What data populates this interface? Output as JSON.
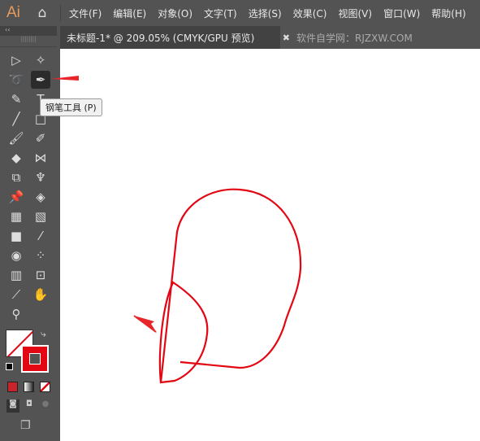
{
  "app": {
    "logo": "Ai",
    "home_icon": "home-icon"
  },
  "menu": [
    "文件(F)",
    "编辑(E)",
    "对象(O)",
    "文字(T)",
    "选择(S)",
    "效果(C)",
    "视图(V)",
    "窗口(W)",
    "帮助(H)"
  ],
  "tab": {
    "title": "未标题-1* @ 209.05% (CMYK/GPU 预览)",
    "close": "✖"
  },
  "watermark": "软件自学网：RJZXW.COM",
  "toolbar": {
    "collapse": "‹‹",
    "tooltip": "钢笔工具 (P)",
    "active_tool": "pen-tool",
    "tools": [
      "direct-selection",
      "magic-wand",
      "lasso",
      "pen",
      "curvature",
      "type",
      "line",
      "rectangle",
      "paintbrush",
      "shaper",
      "eraser",
      "reflect",
      "scale",
      "puppet-warp",
      "pin",
      "perspective",
      "mesh",
      "live-paint",
      "gradient",
      "eyedropper",
      "blend",
      "symbol-sprayer",
      "column-graph",
      "artboard",
      "knife",
      "hand",
      "zoom"
    ]
  },
  "colors": {
    "stroke": "#e30613",
    "fill": "none",
    "accent": "#e8e8e8"
  }
}
